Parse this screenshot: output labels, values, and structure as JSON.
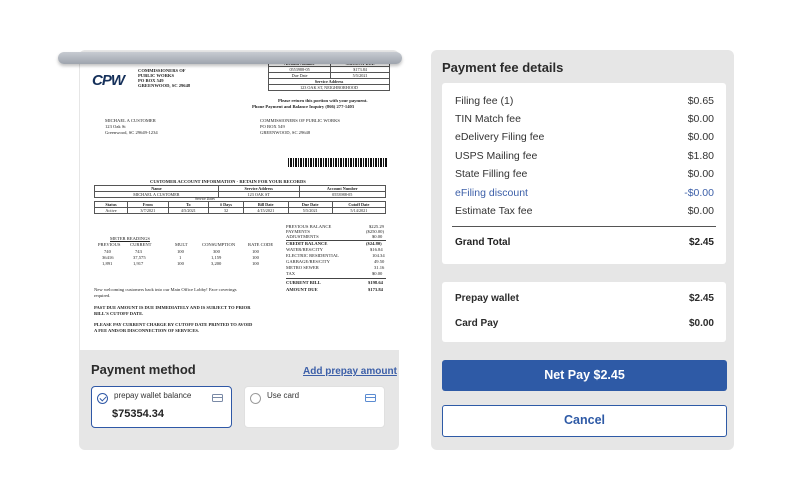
{
  "bill": {
    "logo": "CPW",
    "issuer": [
      "COMMISSIONERS OF",
      "PUBLIC WORKS",
      "PO BOX 549",
      "GREENWOOD, SC 29648"
    ],
    "top_table": {
      "headers": [
        "Account Number",
        "AMOUNT DUE"
      ],
      "account_number": "0553988-05",
      "amount_due": "$173.84",
      "due_date_label": "Due Date",
      "due_date": "5/5/2021",
      "service_address_label": "Service Address",
      "service_address": "123 OAK ST, NEIGHBORHOOD"
    },
    "return_notice": "Please return this portion with your payment.",
    "phone_notice": "Phone Payment and Balance Inquiry (866) 277-1403",
    "customer": [
      "MICHAEL A CUSTOMER",
      "123 Oak St",
      "Greenwood, SC 29649-1234"
    ],
    "remit_to": [
      "COMMISSIONERS OF PUBLIC WORKS",
      "PO BOX 549",
      "GREENWOOD, SC 29648"
    ],
    "info_title": "CUSTOMER ACCOUNT INFORMATION - RETAIN FOR YOUR RECORDS",
    "info_headers": [
      "Name",
      "Service Address",
      "Account Number"
    ],
    "info_values": [
      "MICHAEL A CUSTOMER",
      "123 OAK ST",
      "0553988-05"
    ],
    "service_headers": [
      "Status",
      "From",
      "To",
      "# Days",
      "Bill Date",
      "Due Date",
      "Cutoff Date"
    ],
    "service_dates_label": "Service Dates",
    "service_values": [
      "Active",
      "3/7/2021",
      "4/5/2021",
      "32",
      "4/15/2021",
      "5/5/2021",
      "5/14/2021"
    ],
    "meter_title": "METER READINGS",
    "meter_headers": [
      "PREVIOUS",
      "CURRENT",
      "MULT",
      "CONSUMPTION",
      "RATE CODE"
    ],
    "meter_rows": [
      [
        "740",
        "743",
        "100",
        "300",
        "100"
      ],
      [
        "36416",
        "37,575",
        "1",
        "1,159",
        "100"
      ],
      [
        "1,891",
        "1,917",
        "100",
        "3,200",
        "100"
      ]
    ],
    "charges": [
      [
        "PREVIOUS BALANCE",
        "$225.29"
      ],
      [
        "PAYMENTS",
        "($250.00)"
      ],
      [
        "ADJUSTMENTS",
        "$0.00"
      ],
      [
        "CREDIT BALANCE",
        "($24.80)"
      ],
      [
        "WATER/RES/CITY",
        "$16.84"
      ],
      [
        "ELECTRIC RESIDENTIAL",
        "104.34"
      ],
      [
        "GARBAGE/RES/CITY",
        "49.50"
      ],
      [
        "METRO SEWER",
        "31.16"
      ],
      [
        "TAX",
        "$0.00"
      ],
      [
        "CURRENT BILL",
        "$198.64"
      ],
      [
        "AMOUNT DUE",
        "$173.84"
      ]
    ],
    "messages": [
      "New welcoming customers back into our Main Office Lobby! Face coverings",
      "required.",
      "PAST DUE AMOUNT IS DUE IMMEDIATELY AND IS SUBJECT TO PRIOR",
      "BILL'S CUTOFF DATE.",
      "PLEASE PAY CURRENT CHARGE BY CUTOFF DATE PRINTED TO AVOID",
      "A FEE AND/OR DISCONNECTION OF SERVICES."
    ]
  },
  "payment_method": {
    "title": "Payment method",
    "add_prepay_label": "Add prepay amount",
    "options": [
      {
        "label": "prepay wallet balance",
        "amount": "$75354.34",
        "selected": true,
        "icon": "wallet-icon"
      },
      {
        "label": "Use card",
        "selected": false,
        "icon": "credit-card-icon"
      }
    ]
  },
  "fee_details": {
    "title": "Payment fee details",
    "rows": [
      {
        "label": "Filing fee (1)",
        "value": "$0.65"
      },
      {
        "label": "TIN Match fee",
        "value": "$0.00"
      },
      {
        "label": "eDelivery Filing fee",
        "value": "$0.00"
      },
      {
        "label": "USPS Mailing fee",
        "value": "$1.80"
      },
      {
        "label": "State Filling fee",
        "value": "$0.00"
      },
      {
        "label": "eFiling discount",
        "value": "-$0.00"
      },
      {
        "label": "Estimate Tax fee",
        "value": "$0.00"
      }
    ],
    "total_label": "Grand Total",
    "total_value": "$2.45"
  },
  "payment_split": {
    "rows": [
      {
        "label": "Prepay wallet",
        "value": "$2.45"
      },
      {
        "label": "Card Pay",
        "value": "$0.00"
      }
    ]
  },
  "actions": {
    "net_pay_label": "Net Pay $2.45",
    "cancel_label": "Cancel"
  },
  "colors": {
    "accent": "#2e5aa6",
    "discount": "#3c5fa8",
    "panel_bg": "#e6e6e6"
  }
}
